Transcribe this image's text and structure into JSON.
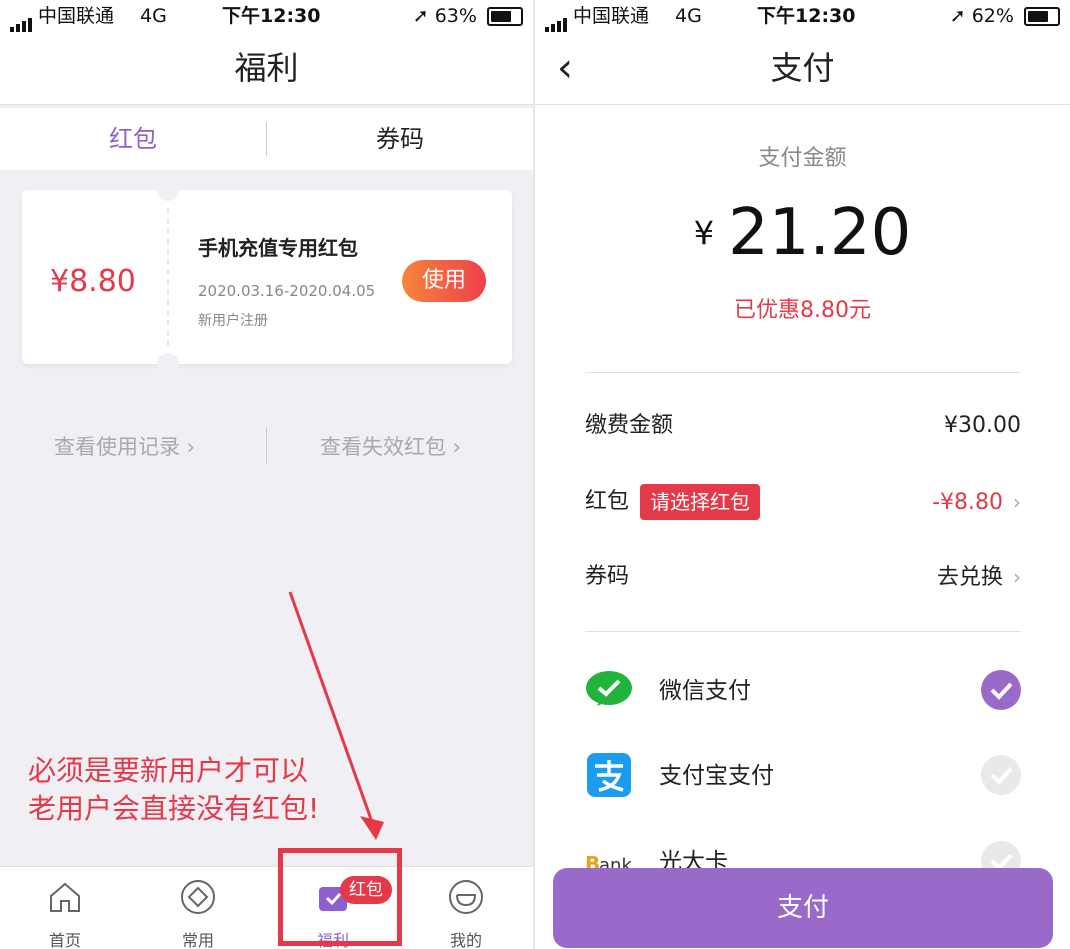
{
  "left": {
    "status": {
      "carrier": "中国联通",
      "network": "4G",
      "time": "下午12:30",
      "battery": "63%",
      "battery_level": 0.63
    },
    "title": "福利",
    "tabs": [
      {
        "label": "红包",
        "active": true
      },
      {
        "label": "券码",
        "active": false
      }
    ],
    "coupon": {
      "amount": "¥8.80",
      "title": "手机充值专用红包",
      "date_range": "2020.03.16-2020.04.05",
      "note": "新用户注册",
      "use_label": "使用"
    },
    "links": {
      "history": "查看使用记录",
      "expired": "查看失效红包"
    },
    "annotation": {
      "line1": "必须是要新用户才可以",
      "line2": "老用户会直接没有红包!"
    },
    "tabbar": {
      "items": [
        {
          "label": "首页",
          "icon": "home-icon"
        },
        {
          "label": "常用",
          "icon": "diamond-icon"
        },
        {
          "label": "福利",
          "icon": "gift-icon",
          "active": true
        },
        {
          "label": "我的",
          "icon": "smile-icon"
        }
      ],
      "badge": "红包"
    }
  },
  "right": {
    "status": {
      "carrier": "中国联通",
      "network": "4G",
      "time": "下午12:30",
      "battery": "62%",
      "battery_level": 0.62
    },
    "title": "支付",
    "pay_label": "支付金额",
    "currency": "¥",
    "amount": "21.20",
    "discount": "已优惠8.80元",
    "rows": {
      "fee": {
        "label": "缴费金额",
        "value": "¥30.00"
      },
      "redpacket": {
        "label": "红包",
        "tag": "请选择红包",
        "value": "-¥8.80"
      },
      "voucher": {
        "label": "券码",
        "value": "去兑换"
      }
    },
    "methods": [
      {
        "name": "微信支付",
        "icon": "wechat-pay-icon",
        "selected": true
      },
      {
        "name": "支付宝支付",
        "icon": "alipay-icon",
        "selected": false
      },
      {
        "name": "光大卡",
        "icon": "bank-card-icon",
        "selected": false
      }
    ],
    "pay_button": "支付"
  },
  "colors": {
    "accent": "#9a6acb",
    "red": "#e5394a",
    "wechat": "#22b43a",
    "alipay": "#1a9cf0"
  }
}
